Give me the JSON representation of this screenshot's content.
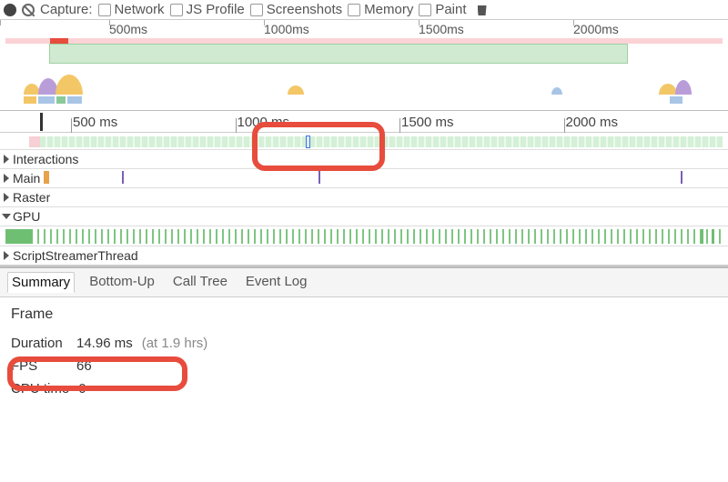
{
  "toolbar": {
    "capture_label": "Capture:",
    "options": [
      "Network",
      "JS Profile",
      "Screenshots",
      "Memory",
      "Paint"
    ]
  },
  "overview_ruler": [
    "500ms",
    "1000ms",
    "1500ms",
    "2000ms"
  ],
  "track_ruler": [
    "500 ms",
    "1000 ms",
    "1500 ms",
    "2000 ms"
  ],
  "tracks": {
    "interactions": "Interactions",
    "main": "Main",
    "raster": "Raster",
    "gpu": "GPU",
    "script_streamer": "ScriptStreamerThread"
  },
  "detail_tabs": [
    "Summary",
    "Bottom-Up",
    "Call Tree",
    "Event Log"
  ],
  "detail_active_tab": 0,
  "frame_panel": {
    "title": "Frame",
    "rows": [
      {
        "key": "Duration",
        "value": "14.96 ms",
        "hint": "(at 1.9 hrs)"
      },
      {
        "key": "FPS",
        "value": "66",
        "hint": ""
      },
      {
        "key": "CPU time",
        "value": "0",
        "hint": ""
      }
    ]
  }
}
